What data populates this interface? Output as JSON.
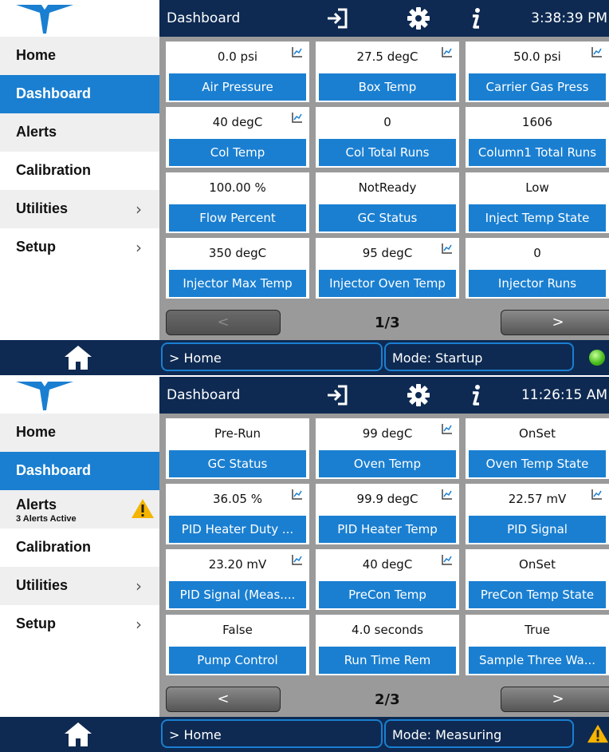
{
  "screens": [
    {
      "title": "Dashboard",
      "time": "3:38:39 PM",
      "sidebar": [
        {
          "label": "Home"
        },
        {
          "label": "Dashboard"
        },
        {
          "label": "Alerts",
          "sub": ""
        },
        {
          "label": "Calibration"
        },
        {
          "label": "Utilities",
          "chevron": "›"
        },
        {
          "label": "Setup",
          "chevron": "›"
        }
      ],
      "tiles": [
        {
          "value": "0.0 psi",
          "label": "Air Pressure",
          "chart": true
        },
        {
          "value": "27.5 degC",
          "label": "Box Temp",
          "chart": true
        },
        {
          "value": "50.0 psi",
          "label": "Carrier Gas Press",
          "chart": true
        },
        {
          "value": "40 degC",
          "label": "Col Temp",
          "chart": true
        },
        {
          "value": "0",
          "label": "Col Total Runs",
          "chart": false
        },
        {
          "value": "1606",
          "label": "Column1 Total Runs",
          "chart": false
        },
        {
          "value": "100.00 %",
          "label": "Flow Percent",
          "chart": false
        },
        {
          "value": "NotReady",
          "label": "GC Status",
          "chart": false
        },
        {
          "value": "Low",
          "label": "Inject Temp State",
          "chart": false
        },
        {
          "value": "350 degC",
          "label": "Injector Max Temp",
          "chart": false
        },
        {
          "value": "95 degC",
          "label": "Injector Oven Temp",
          "chart": true
        },
        {
          "value": "0",
          "label": "Injector Runs",
          "chart": false
        }
      ],
      "pager": {
        "prev": "<",
        "next": ">",
        "page": "1/3"
      },
      "breadcrumb": "> Home",
      "mode": "Mode: Startup",
      "status_icon": "status-ok-icon"
    },
    {
      "title": "Dashboard",
      "time": "11:26:15 AM",
      "sidebar": [
        {
          "label": "Home"
        },
        {
          "label": "Dashboard"
        },
        {
          "label": "Alerts",
          "sub": "3 Alerts Active"
        },
        {
          "label": "Calibration"
        },
        {
          "label": "Utilities",
          "chevron": "›"
        },
        {
          "label": "Setup",
          "chevron": "›"
        }
      ],
      "tiles": [
        {
          "value": "Pre-Run",
          "label": "GC Status",
          "chart": false
        },
        {
          "value": "99 degC",
          "label": "Oven Temp",
          "chart": true
        },
        {
          "value": "OnSet",
          "label": "Oven Temp State",
          "chart": false
        },
        {
          "value": "36.05 %",
          "label": "PID Heater Duty ...",
          "chart": true
        },
        {
          "value": "99.9 degC",
          "label": "PID Heater Temp",
          "chart": true
        },
        {
          "value": "22.57 mV",
          "label": "PID Signal",
          "chart": true
        },
        {
          "value": "23.20 mV",
          "label": "PID Signal (Meas....",
          "chart": true
        },
        {
          "value": "40 degC",
          "label": "PreCon Temp",
          "chart": true
        },
        {
          "value": "OnSet",
          "label": "PreCon Temp State",
          "chart": false
        },
        {
          "value": "False",
          "label": "Pump Control",
          "chart": false
        },
        {
          "value": "4.0 seconds",
          "label": "Run Time Rem",
          "chart": false
        },
        {
          "value": "True",
          "label": "Sample Three Wa...",
          "chart": false
        }
      ],
      "pager": {
        "prev": "<",
        "next": ">",
        "page": "2/3"
      },
      "breadcrumb": "> Home",
      "mode": "Mode: Measuring",
      "status_icon": "warning-icon"
    }
  ],
  "colors": {
    "navy": "#0e2a52",
    "blue": "#1a7fd1",
    "gray_bg": "#9a9a9a",
    "warning": "#f5b400"
  }
}
